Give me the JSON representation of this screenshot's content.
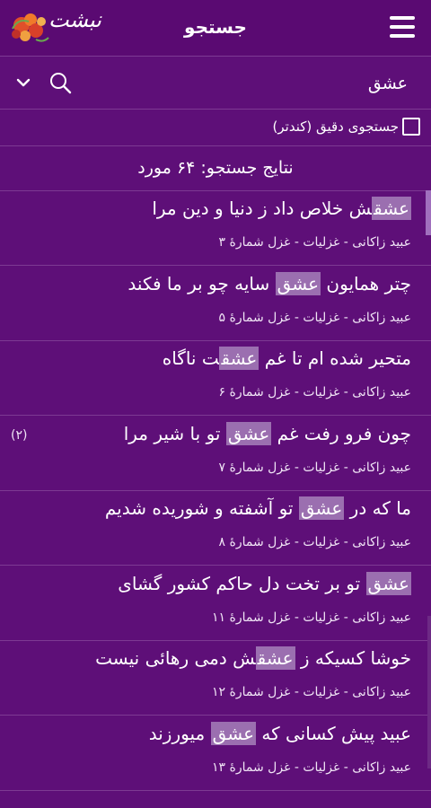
{
  "header": {
    "title": "جستجو",
    "logo_text": "نبشت"
  },
  "search": {
    "value": "عشق",
    "placeholder": ""
  },
  "exact": {
    "label": "جستجوی دقیق (کندتر)",
    "checked": false
  },
  "results": {
    "count_label": "نتایج جستجو: ۶۴ مورد",
    "items": [
      {
        "pre": "",
        "hl": "عشق",
        "post": "ش خلاص داد ز دنیا و دین مرا",
        "meta": "عبید زاکانی - غزلیات - غزل شمارهٔ ۳",
        "badge": ""
      },
      {
        "pre": "چتر همایون ",
        "hl": "عشق",
        "post": " سایه چو بر ما فکند",
        "meta": "عبید زاکانی - غزلیات - غزل شمارهٔ ۵",
        "badge": ""
      },
      {
        "pre": "متحیر شده ام تا غم ",
        "hl": "عشق",
        "post": "ت ناگاه",
        "meta": "عبید زاکانی - غزلیات - غزل شمارهٔ ۶",
        "badge": ""
      },
      {
        "pre": "چون فرو رفت غم ",
        "hl": "عشق",
        "post": " تو با شیر مرا",
        "meta": "عبید زاکانی - غزلیات - غزل شمارهٔ ۷",
        "badge": "(۲)"
      },
      {
        "pre": "ما که در ",
        "hl": "عشق",
        "post": " تو آشفته و شوریده شدیم",
        "meta": "عبید زاکانی - غزلیات - غزل شمارهٔ ۸",
        "badge": ""
      },
      {
        "pre": "",
        "hl": "عشق",
        "post": " تو بر تخت دل حاکم کشور گشای",
        "meta": "عبید زاکانی - غزلیات - غزل شمارهٔ ۱۱",
        "badge": ""
      },
      {
        "pre": "خوشا کسیکه ز ",
        "hl": "عشق",
        "post": "ش دمی رهائی نیست",
        "meta": "عبید زاکانی - غزلیات - غزل شمارهٔ ۱۲",
        "badge": ""
      },
      {
        "pre": "عبید پیش کسانی که ",
        "hl": "عشق",
        "post": " میورزند",
        "meta": "عبید زاکانی - غزلیات - غزل شمارهٔ ۱۳",
        "badge": ""
      }
    ]
  },
  "colors": {
    "background": "#5e0f78",
    "highlight": "#9b6fb0"
  }
}
